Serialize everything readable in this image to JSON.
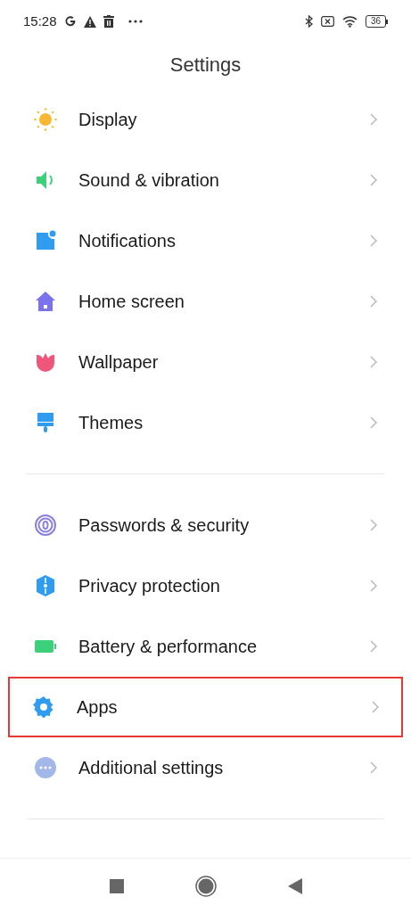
{
  "status_bar": {
    "time": "15:28",
    "battery": "36"
  },
  "title": "Settings",
  "groups": [
    {
      "items": [
        {
          "label": "Display",
          "kind": "sun",
          "highlighted": false
        },
        {
          "label": "Sound & vibration",
          "kind": "speaker",
          "highlighted": false
        },
        {
          "label": "Notifications",
          "kind": "notification",
          "highlighted": false
        },
        {
          "label": "Home screen",
          "kind": "house",
          "highlighted": false
        },
        {
          "label": "Wallpaper",
          "kind": "tulip",
          "highlighted": false
        },
        {
          "label": "Themes",
          "kind": "brush",
          "highlighted": false
        }
      ]
    },
    {
      "items": [
        {
          "label": "Passwords & security",
          "kind": "fingerprint",
          "highlighted": false
        },
        {
          "label": "Privacy protection",
          "kind": "shield",
          "highlighted": false
        },
        {
          "label": "Battery & performance",
          "kind": "battery",
          "highlighted": false
        },
        {
          "label": "Apps",
          "kind": "gear",
          "highlighted": true
        },
        {
          "label": "Additional settings",
          "kind": "dots",
          "highlighted": false
        }
      ]
    }
  ]
}
